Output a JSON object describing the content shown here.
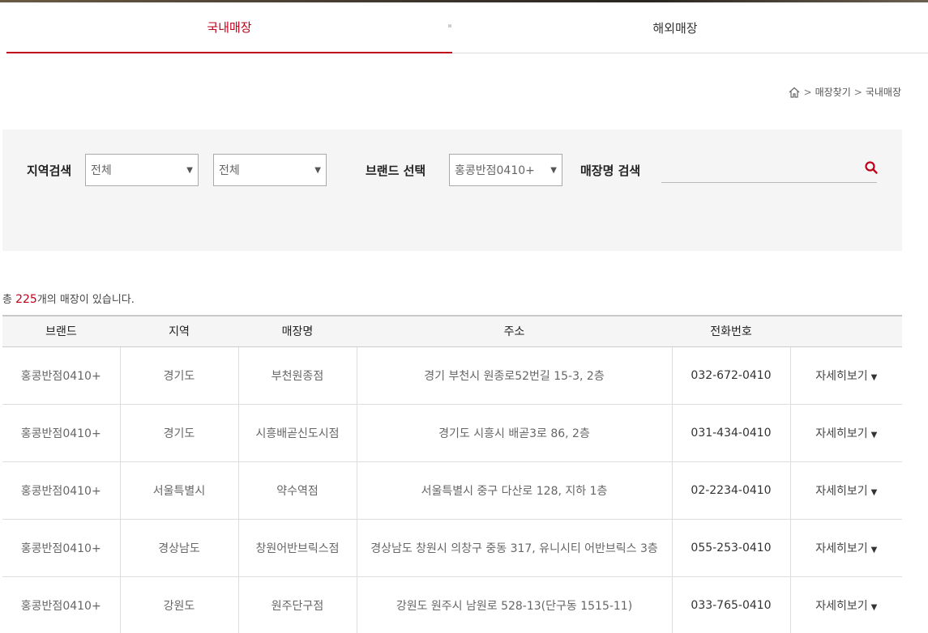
{
  "tabs": {
    "domestic": "국내매장",
    "overseas": "해외매장"
  },
  "breadcrumb": {
    "items": [
      "매장찾기",
      "국내매장"
    ],
    "separator": ">"
  },
  "search": {
    "region_label": "지역검색",
    "region1_value": "전체",
    "region2_value": "전체",
    "brand_label": "브랜드 선택",
    "brand_value": "홍콩반점0410+",
    "store_label": "매장명 검색",
    "store_value": ""
  },
  "summary": {
    "prefix": "총 ",
    "count": "225",
    "suffix": "개의 매장이 있습니다."
  },
  "table": {
    "headers": [
      "브랜드",
      "지역",
      "매장명",
      "주소",
      "전화번호",
      ""
    ],
    "rows": [
      {
        "brand": "홍콩반점0410+",
        "region": "경기도",
        "store": "부천원종점",
        "address": "경기 부천시 원종로52번길 15-3, 2층",
        "phone": "032-672-0410",
        "detail": "자세히보기"
      },
      {
        "brand": "홍콩반점0410+",
        "region": "경기도",
        "store": "시흥배곧신도시점",
        "address": "경기도 시흥시 배곧3로 86, 2층",
        "phone": "031-434-0410",
        "detail": "자세히보기"
      },
      {
        "brand": "홍콩반점0410+",
        "region": "서울특별시",
        "store": "약수역점",
        "address": "서울특별시 중구 다산로 128, 지하 1층",
        "phone": "02-2234-0410",
        "detail": "자세히보기"
      },
      {
        "brand": "홍콩반점0410+",
        "region": "경상남도",
        "store": "창원어반브릭스점",
        "address": "경상남도 창원시 의창구 중동 317, 유니시티 어반브릭스 3층",
        "phone": "055-253-0410",
        "detail": "자세히보기"
      },
      {
        "brand": "홍콩반점0410+",
        "region": "강원도",
        "store": "원주단구점",
        "address": "강원도 원주시 남원로 528-13(단구동 1515-11)",
        "phone": "033-765-0410",
        "detail": "자세히보기"
      }
    ]
  },
  "colors": {
    "accent": "#c0001a",
    "panel": "#f5f5f5"
  }
}
